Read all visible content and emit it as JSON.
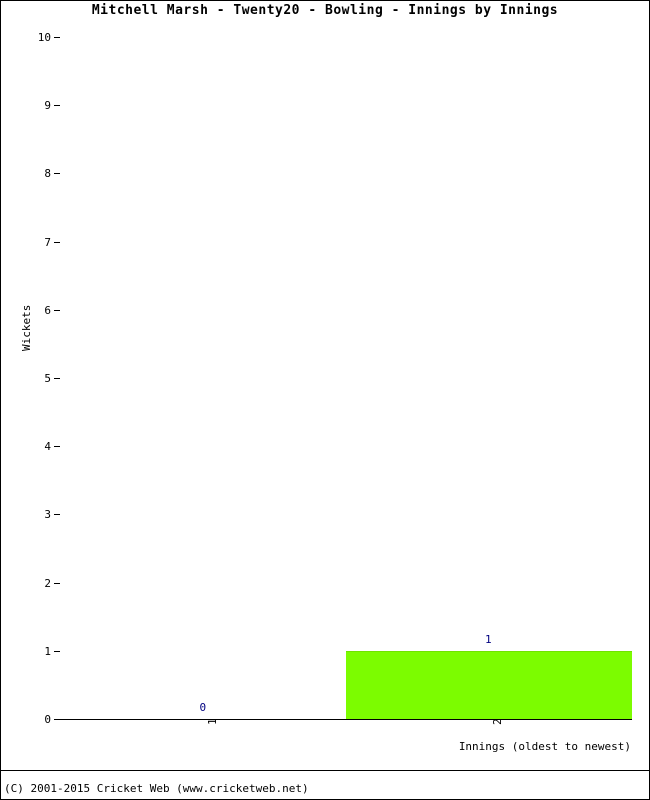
{
  "chart_data": {
    "type": "bar",
    "title": "Mitchell Marsh - Twenty20 - Bowling - Innings by Innings",
    "xlabel": "Innings (oldest to newest)",
    "ylabel": "Wickets",
    "categories": [
      "1",
      "2"
    ],
    "values": [
      0,
      1
    ],
    "data_labels": [
      "0",
      "1"
    ],
    "ylim": [
      0,
      10
    ],
    "ytick_labels": [
      "0",
      "1",
      "2",
      "3",
      "4",
      "5",
      "6",
      "7",
      "8",
      "9",
      "10"
    ],
    "ytick_values": [
      0,
      1,
      2,
      3,
      4,
      5,
      6,
      7,
      8,
      9,
      10
    ],
    "grid": true,
    "legend": false,
    "bar_color": "#7cfc00",
    "label_color": "#000080",
    "grid_color": "#dcdcdc",
    "axis_color": "#000000",
    "orientation": "vertical"
  },
  "footer": {
    "copyright": "(C) 2001-2015 Cricket Web (www.cricketweb.net)"
  }
}
